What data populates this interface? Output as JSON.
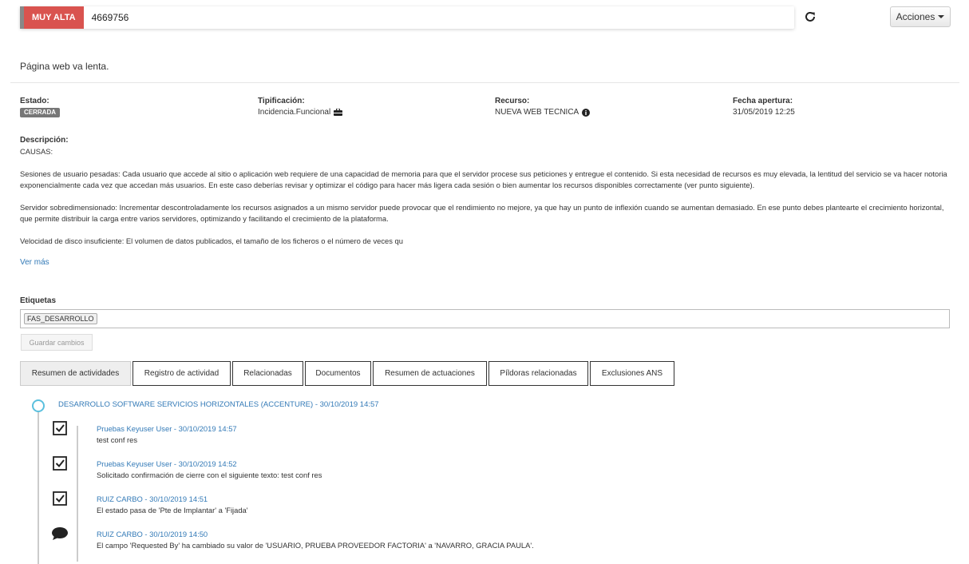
{
  "header": {
    "priority": "MUY ALTA",
    "ticket_id": "4669756",
    "actions_label": "Acciones"
  },
  "summary": "Página web va lenta.",
  "fields": {
    "estado": {
      "label": "Estado:",
      "value": "CERRADA"
    },
    "tipificacion": {
      "label": "Tipificación:",
      "value": "Incidencia.Funcional"
    },
    "recurso": {
      "label": "Recurso:",
      "value": "NUEVA WEB TECNICA"
    },
    "fecha": {
      "label": "Fecha apertura:",
      "value": "31/05/2019 12:25"
    }
  },
  "description": {
    "label": "Descripción:",
    "paragraphs": [
      "CAUSAS:",
      "Sesiones de usuario pesadas: Cada usuario que accede al sitio o aplicación web requiere de una capacidad de memoria para que el servidor procese sus peticiones y entregue el contenido. Si esta necesidad de recursos es muy elevada, la lentitud del servicio se va hacer notoria exponencialmente cada vez que accedan más usuarios. En este caso deberías revisar y optimizar el código para hacer más ligera cada sesión o bien aumentar los recursos disponibles correctamente (ver punto siguiente).",
      "Servidor sobredimensionado: Incrementar descontroladamente los recursos asignados a un mismo servidor puede provocar que el rendimiento no mejore, ya que hay un punto de inflexión cuando se aumentan demasiado. En ese punto debes plantearte el crecimiento horizontal, que permite distribuir la carga entre varios servidores, optimizando y facilitando el crecimiento de la plataforma.",
      "Velocidad de disco insuficiente: El volumen de datos publicados, el tamaño de los ficheros o el número de veces qu"
    ],
    "more_link": "Ver más"
  },
  "tags": {
    "label": "Etiquetas",
    "items": [
      "FAS_DESARROLLO"
    ],
    "save_label": "Guardar cambios"
  },
  "tabs": [
    "Resumen de actividades",
    "Registro de actividad",
    "Relacionadas",
    "Documentos",
    "Resumen de actuaciones",
    "Píldoras relacionadas",
    "Exclusiones ANS"
  ],
  "timeline": {
    "group_title": "DESARROLLO SOFTWARE SERVICIOS HORIZONTALES (ACCENTURE)  -  30/10/2019 14:57",
    "entries": [
      {
        "icon": "checkbox-icon",
        "title": "Pruebas Keyuser User  -  30/10/2019 14:57",
        "text": "test conf res"
      },
      {
        "icon": "checkbox-icon",
        "title": "Pruebas Keyuser User  -  30/10/2019 14:52",
        "text": "Solicitado confirmación de cierre con el siguiente texto: test conf res"
      },
      {
        "icon": "checkbox-icon",
        "title": "RUIZ CARBO  -  30/10/2019 14:51",
        "text": "El estado pasa de 'Pte de Implantar' a 'Fijada'"
      },
      {
        "icon": "comment-icon",
        "title": "RUIZ CARBO  -  30/10/2019 14:50",
        "text": "El campo 'Requested By' ha cambiado su valor de 'USUARIO, PRUEBA PROVEEDOR FACTORIA' a 'NAVARRO, GRACIA PAULA'."
      }
    ]
  },
  "colors": {
    "priority": "#d9534f",
    "link": "#337ab7",
    "timeline_circle": "#5bc0de"
  }
}
